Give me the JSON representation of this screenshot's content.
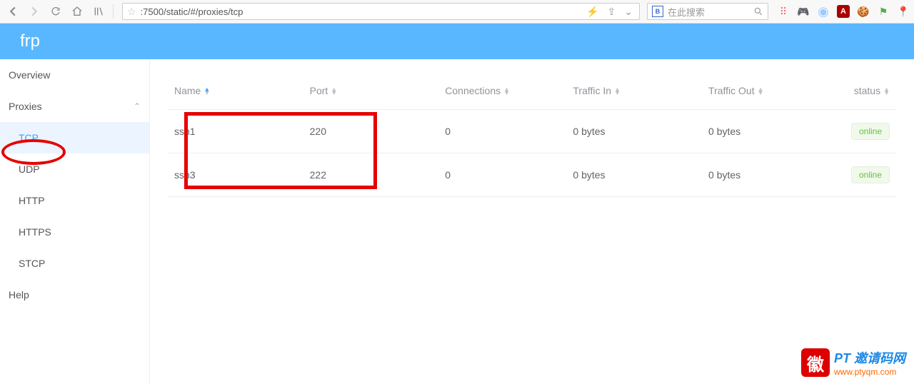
{
  "browser": {
    "url": ":7500/static/#/proxies/tcp",
    "search_placeholder": "在此搜索"
  },
  "header": {
    "title": "frp"
  },
  "sidebar": {
    "overview": "Overview",
    "proxies_label": "Proxies",
    "items": {
      "tcp": "TCP",
      "udp": "UDP",
      "http": "HTTP",
      "https": "HTTPS",
      "stcp": "STCP"
    },
    "help": "Help"
  },
  "table": {
    "headers": {
      "name": "Name",
      "port": "Port",
      "connections": "Connections",
      "traffic_in": "Traffic In",
      "traffic_out": "Traffic Out",
      "status": "status"
    },
    "rows": [
      {
        "name": "ssh1",
        "port": "220",
        "connections": "0",
        "traffic_in": "0 bytes",
        "traffic_out": "0 bytes",
        "status": "online"
      },
      {
        "name": "ssh3",
        "port": "222",
        "connections": "0",
        "traffic_in": "0 bytes",
        "traffic_out": "0 bytes",
        "status": "online"
      }
    ]
  },
  "watermark": {
    "title": "PT 邀请码网",
    "url": "www.ptyqm.com"
  }
}
